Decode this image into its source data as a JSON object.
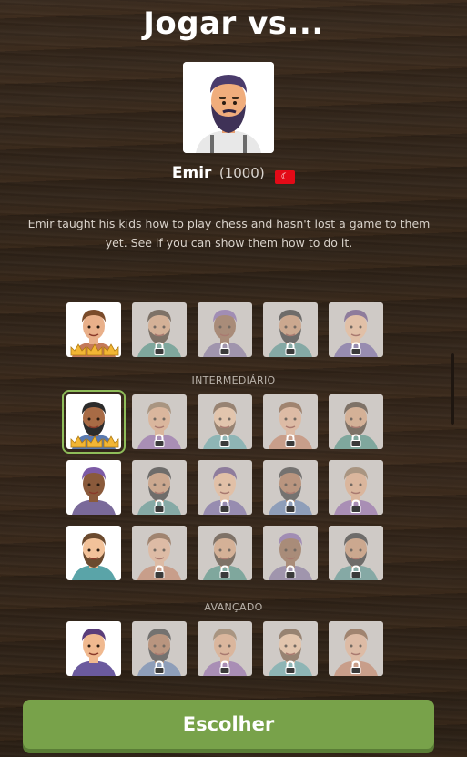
{
  "header": {
    "title": "Jogar vs..."
  },
  "selected_bot": {
    "name": "Emir",
    "rating": "(1000)",
    "flag_icon": "turkey-flag",
    "description": "Emir taught his kids how to play chess and hasn't lost a game to them yet. See if you can show them how to do it."
  },
  "sections": {
    "intermediate": "INTERMEDIÁRIO",
    "advanced": "AVANÇADO"
  },
  "colors": {
    "accent_green": "#78a24a",
    "selection_outline": "#8fbd5a",
    "lock_gold": "#f2b634"
  },
  "bot_rows": [
    {
      "row": "beginner-top",
      "bots": [
        {
          "state": "completed-3-crowns"
        },
        {
          "state": "locked"
        },
        {
          "state": "locked"
        },
        {
          "state": "locked"
        },
        {
          "state": "locked"
        }
      ]
    },
    {
      "row": "intermediate-1",
      "bots": [
        {
          "state": "selected-3-crowns"
        },
        {
          "state": "locked"
        },
        {
          "state": "locked"
        },
        {
          "state": "locked"
        },
        {
          "state": "locked"
        }
      ]
    },
    {
      "row": "intermediate-2",
      "bots": [
        {
          "state": "available"
        },
        {
          "state": "locked"
        },
        {
          "state": "locked"
        },
        {
          "state": "locked"
        },
        {
          "state": "locked"
        }
      ]
    },
    {
      "row": "intermediate-3",
      "bots": [
        {
          "state": "available"
        },
        {
          "state": "locked"
        },
        {
          "state": "locked"
        },
        {
          "state": "locked"
        },
        {
          "state": "locked"
        }
      ]
    },
    {
      "row": "advanced-1",
      "bots": [
        {
          "state": "available"
        },
        {
          "state": "locked"
        },
        {
          "state": "locked"
        },
        {
          "state": "locked"
        },
        {
          "state": "locked"
        }
      ]
    }
  ],
  "actions": {
    "choose_label": "Escolher"
  }
}
